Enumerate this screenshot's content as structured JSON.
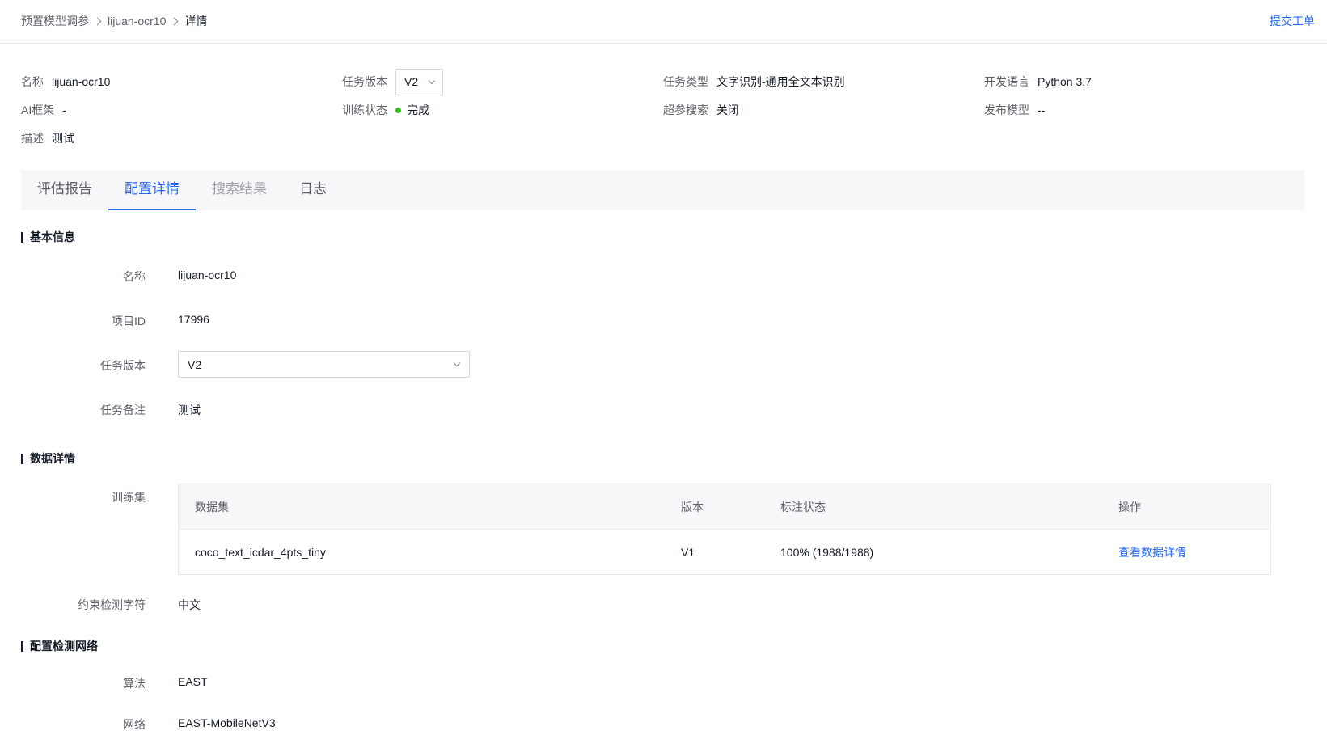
{
  "breadcrumb": {
    "items": [
      "预置模型调参",
      "lijuan-ocr10",
      "详情"
    ]
  },
  "header": {
    "ticket_link": "提交工单"
  },
  "summary": {
    "name": {
      "label": "名称",
      "value": "lijuan-ocr10"
    },
    "task_version": {
      "label": "任务版本",
      "value": "V2"
    },
    "task_type": {
      "label": "任务类型",
      "value": "文字识别-通用全文本识别"
    },
    "dev_language": {
      "label": "开发语言",
      "value": "Python 3.7"
    },
    "ai_framework": {
      "label": "AI框架",
      "value": "-"
    },
    "train_status": {
      "label": "训练状态",
      "value": "完成",
      "status_color": "#30bf13"
    },
    "hyperparam_search": {
      "label": "超参搜索",
      "value": "关闭"
    },
    "publish_model": {
      "label": "发布模型",
      "value": "--"
    },
    "description": {
      "label": "描述",
      "value": "测试"
    }
  },
  "tabs": [
    {
      "label": "评估报告",
      "state": "normal"
    },
    {
      "label": "配置详情",
      "state": "active"
    },
    {
      "label": "搜索结果",
      "state": "disabled"
    },
    {
      "label": "日志",
      "state": "normal"
    }
  ],
  "basic_info": {
    "title": "基本信息",
    "name": {
      "label": "名称",
      "value": "lijuan-ocr10"
    },
    "project_id": {
      "label": "项目ID",
      "value": "17996"
    },
    "task_version": {
      "label": "任务版本",
      "value": "V2"
    },
    "task_note": {
      "label": "任务备注",
      "value": "测试"
    }
  },
  "data_details": {
    "title": "数据详情",
    "train_set_label": "训练集",
    "table": {
      "headers": [
        "数据集",
        "版本",
        "标注状态",
        "操作"
      ],
      "rows": [
        {
          "dataset": "coco_text_icdar_4pts_tiny",
          "version": "V1",
          "label_status": "100% (1988/1988)",
          "action": "查看数据详情"
        }
      ]
    },
    "constraint": {
      "label": "约束检测字符",
      "value": "中文"
    }
  },
  "detect_network": {
    "title": "配置检测网络",
    "algorithm": {
      "label": "算法",
      "value": "EAST"
    },
    "network": {
      "label": "网络",
      "value": "EAST-MobileNetV3"
    }
  },
  "colors": {
    "accent": "#2468f2",
    "text": "#151b26",
    "muted": "#5c5f66",
    "success": "#30bf13"
  }
}
